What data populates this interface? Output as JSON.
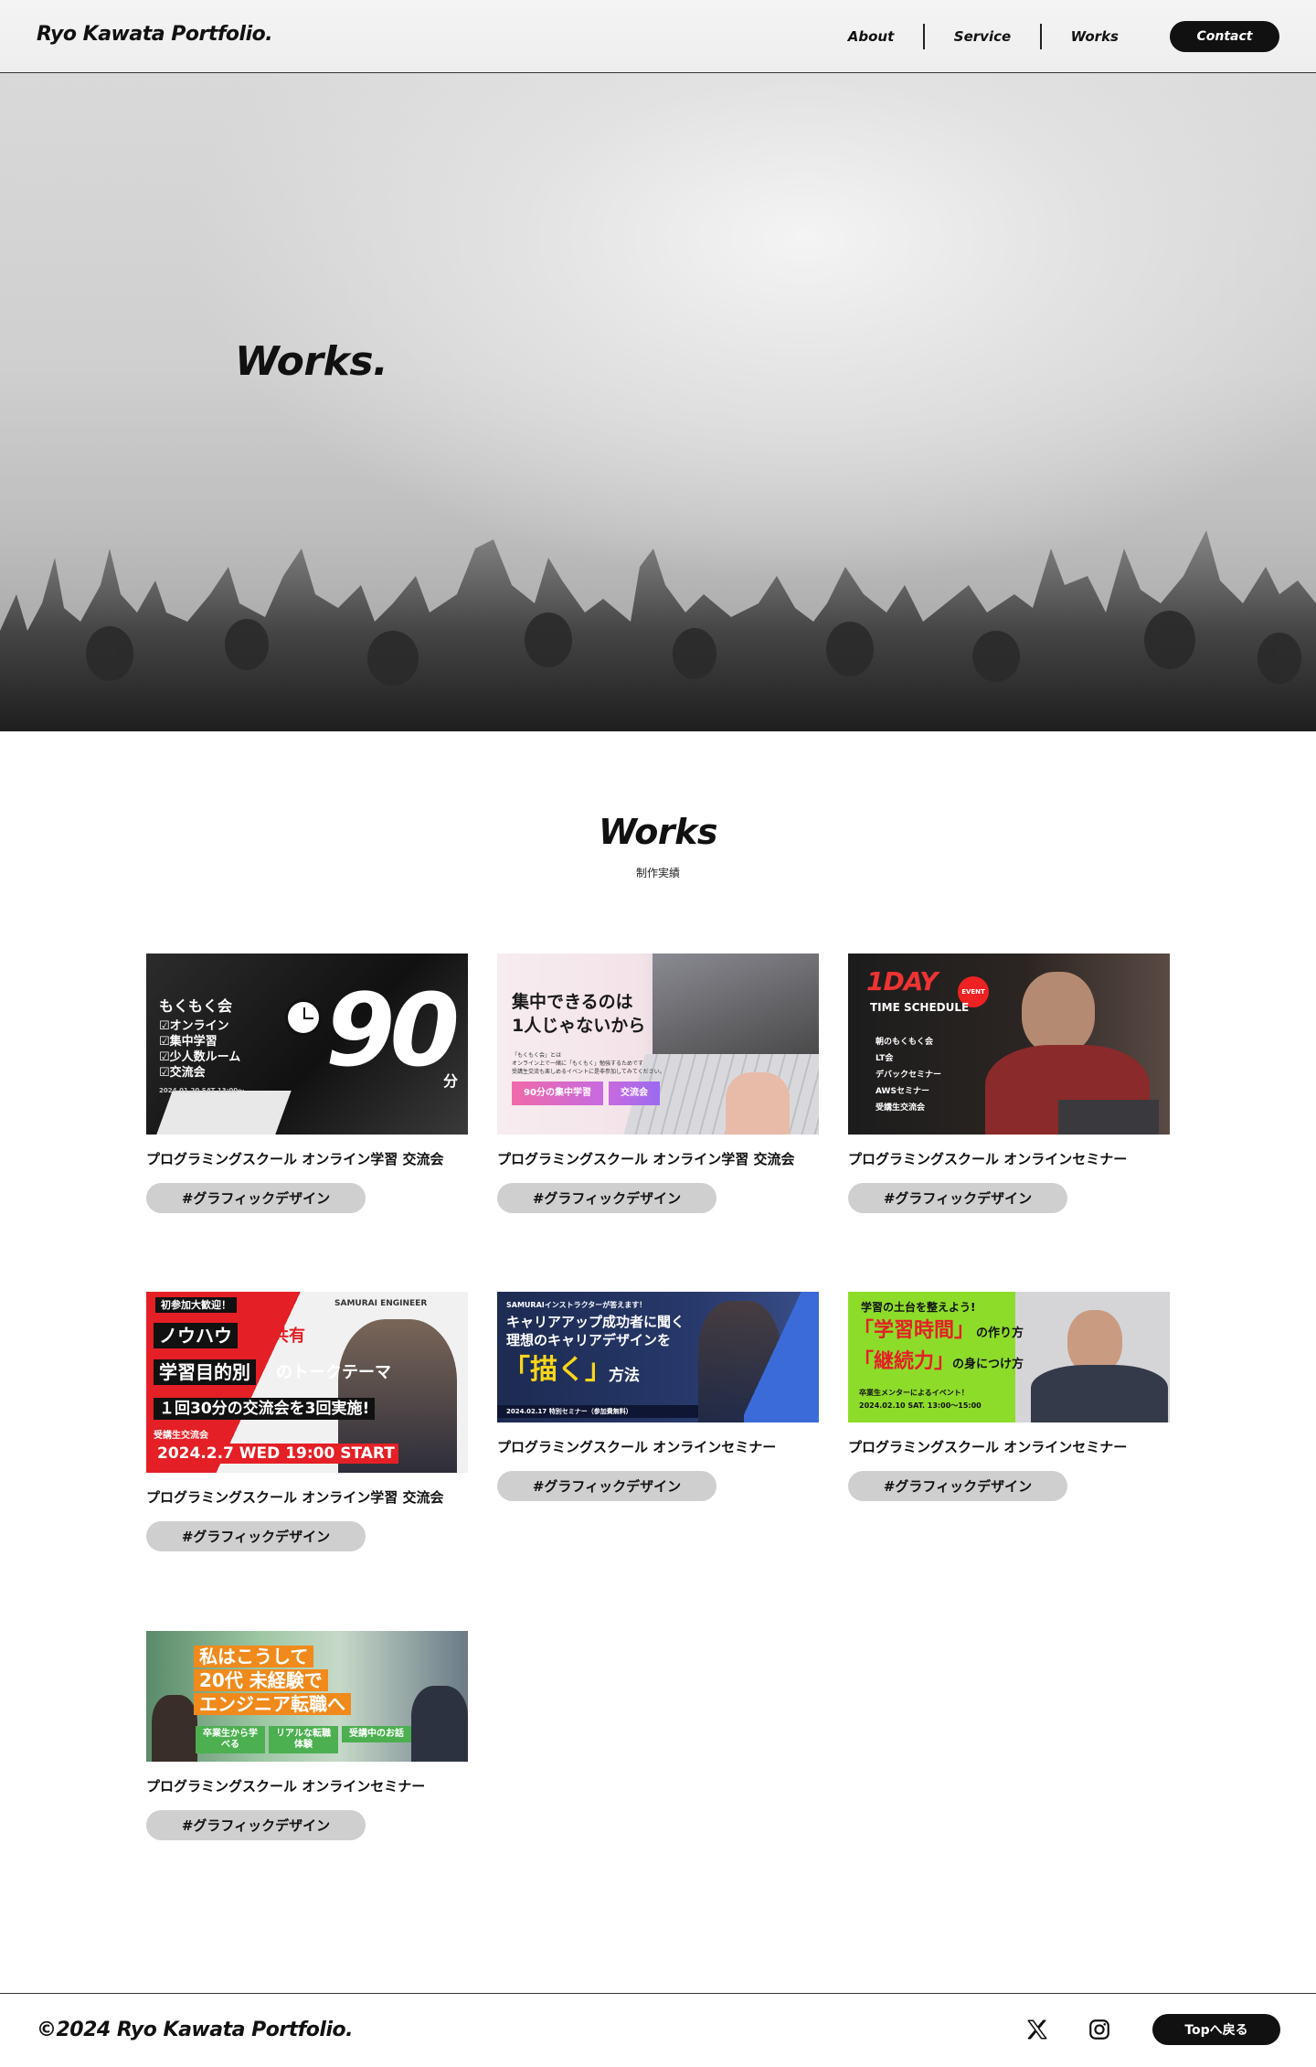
{
  "header": {
    "logo": "Ryo Kawata Portfolio.",
    "nav": {
      "about": "About",
      "service": "Service",
      "works": "Works",
      "contact": "Contact"
    }
  },
  "hero": {
    "title": "Works."
  },
  "section": {
    "title": "Works",
    "subtitle": "制作実績"
  },
  "works": [
    {
      "title": "プログラミングスクール オンライン学習 交流会",
      "tag": "#グラフィックデザイン",
      "thumb": {
        "heading": "もくもく会",
        "items": [
          "☑オンライン",
          "☑集中学習",
          "☑少人数ルーム",
          "☑交流会"
        ],
        "big": "90",
        "unit": "分",
        "date": "2024.01.20 SAT 13:00〜"
      }
    },
    {
      "title": "プログラミングスクール オンライン学習 交流会",
      "tag": "#グラフィックデザイン",
      "thumb": {
        "line1": "集中できるのは",
        "line2": "1人じゃないから",
        "desc1": "「もくもく会」とは",
        "desc2": "オンライン上で一緒に「もくもく」勉強するためです",
        "desc3": "受講生交流も楽しめるイベントに是非参加してみてください。",
        "badge1": "90分の集中学習",
        "badge2": "交流会"
      }
    },
    {
      "title": "プログラミングスクール オンラインセミナー",
      "tag": "#グラフィックデザイン",
      "thumb": {
        "big": "1DAY",
        "event": "EVENT",
        "sub": "TIME SCHEDULE",
        "s1": "朝のもくもく会",
        "s2": "LT会",
        "s3": "デバックセミナー",
        "s4": "AWSセミナー",
        "s5": "受講生交流会"
      }
    },
    {
      "title": "プログラミングスクール オンライン学習 交流会",
      "tag": "#グラフィックデザイン",
      "thumb": {
        "top": "初参加大歓迎！",
        "brand": "SAMURAI ENGINEER",
        "l1a": "ノウハウ",
        "l1b": "の共有",
        "l2a": "学習目的別",
        "l2b": "のトークテーマ",
        "l3": "１回30分の交流会を3回実施!",
        "l4": "受講生交流会",
        "l5": "2024.2.7 WED 19:00 START"
      }
    },
    {
      "title": "プログラミングスクール オンラインセミナー",
      "tag": "#グラフィックデザイン",
      "thumb": {
        "top": "SAMURAIインストラクターが答えます！",
        "l1": "キャリアアップ成功者に聞く",
        "l2": "理想のキャリアデザインを",
        "big": "「描く」",
        "l3": "方法",
        "date": "2024.02.17 特別セミナー（参加費無料）"
      }
    },
    {
      "title": "プログラミングスクール オンラインセミナー",
      "tag": "#グラフィックデザイン",
      "thumb": {
        "l1": "学習の土台を整えよう!",
        "l2a": "「学習時間」",
        "l2b": "の作り方",
        "l3a": "「継続力」",
        "l3b": "の身につけ方",
        "l4": "卒業生メンターによるイベント！",
        "l5": "2024.02.10 SAT. 13:00〜15:00"
      }
    },
    {
      "title": "プログラミングスクール オンラインセミナー",
      "tag": "#グラフィックデザイン",
      "thumb": {
        "l1": "私はこうして",
        "l2": "20代 未経験で",
        "l3": "エンジニア転職へ",
        "b1": "卒業生から学べる",
        "b2": "リアルな転職体験",
        "b3": "受講中のお話"
      }
    }
  ],
  "footer": {
    "copyright": "©2024 Ryo Kawata Portfolio.",
    "top_button": "Topへ戻る"
  }
}
